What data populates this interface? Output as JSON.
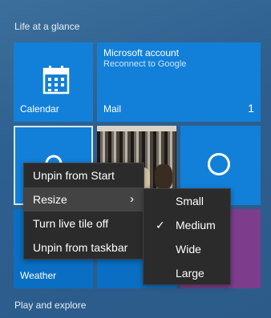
{
  "groups": {
    "life_at_a_glance": "Life at a glance",
    "play_and_explore": "Play and explore"
  },
  "tiles": {
    "calendar": {
      "label": "Calendar",
      "icon": "calendar-icon"
    },
    "mail": {
      "title": "Microsoft account",
      "subtitle": "Reconnect to Google",
      "label": "Mail",
      "count": "1"
    },
    "photos": {
      "icon": "photo-dogs"
    },
    "cortana": {
      "icon": "cortana-circle-icon"
    },
    "weather": {
      "label": "Weather",
      "icon": "weather-icon"
    }
  },
  "context_menu": {
    "items": [
      {
        "label": "Unpin from Start"
      },
      {
        "label": "Resize",
        "has_submenu": true,
        "chevron": "›"
      },
      {
        "label": "Turn live tile off"
      },
      {
        "label": "Unpin from taskbar"
      }
    ]
  },
  "resize_submenu": {
    "items": [
      {
        "label": "Small",
        "checked": false
      },
      {
        "label": "Medium",
        "checked": true,
        "check_glyph": "✓"
      },
      {
        "label": "Wide",
        "checked": false
      },
      {
        "label": "Large",
        "checked": false
      }
    ]
  },
  "colors": {
    "background": "#2d5f8f",
    "tile_blue": "#1280d8",
    "tile_purple": "#7e3c8d",
    "menu_bg": "#2b2b2b",
    "menu_hover": "#434343"
  }
}
